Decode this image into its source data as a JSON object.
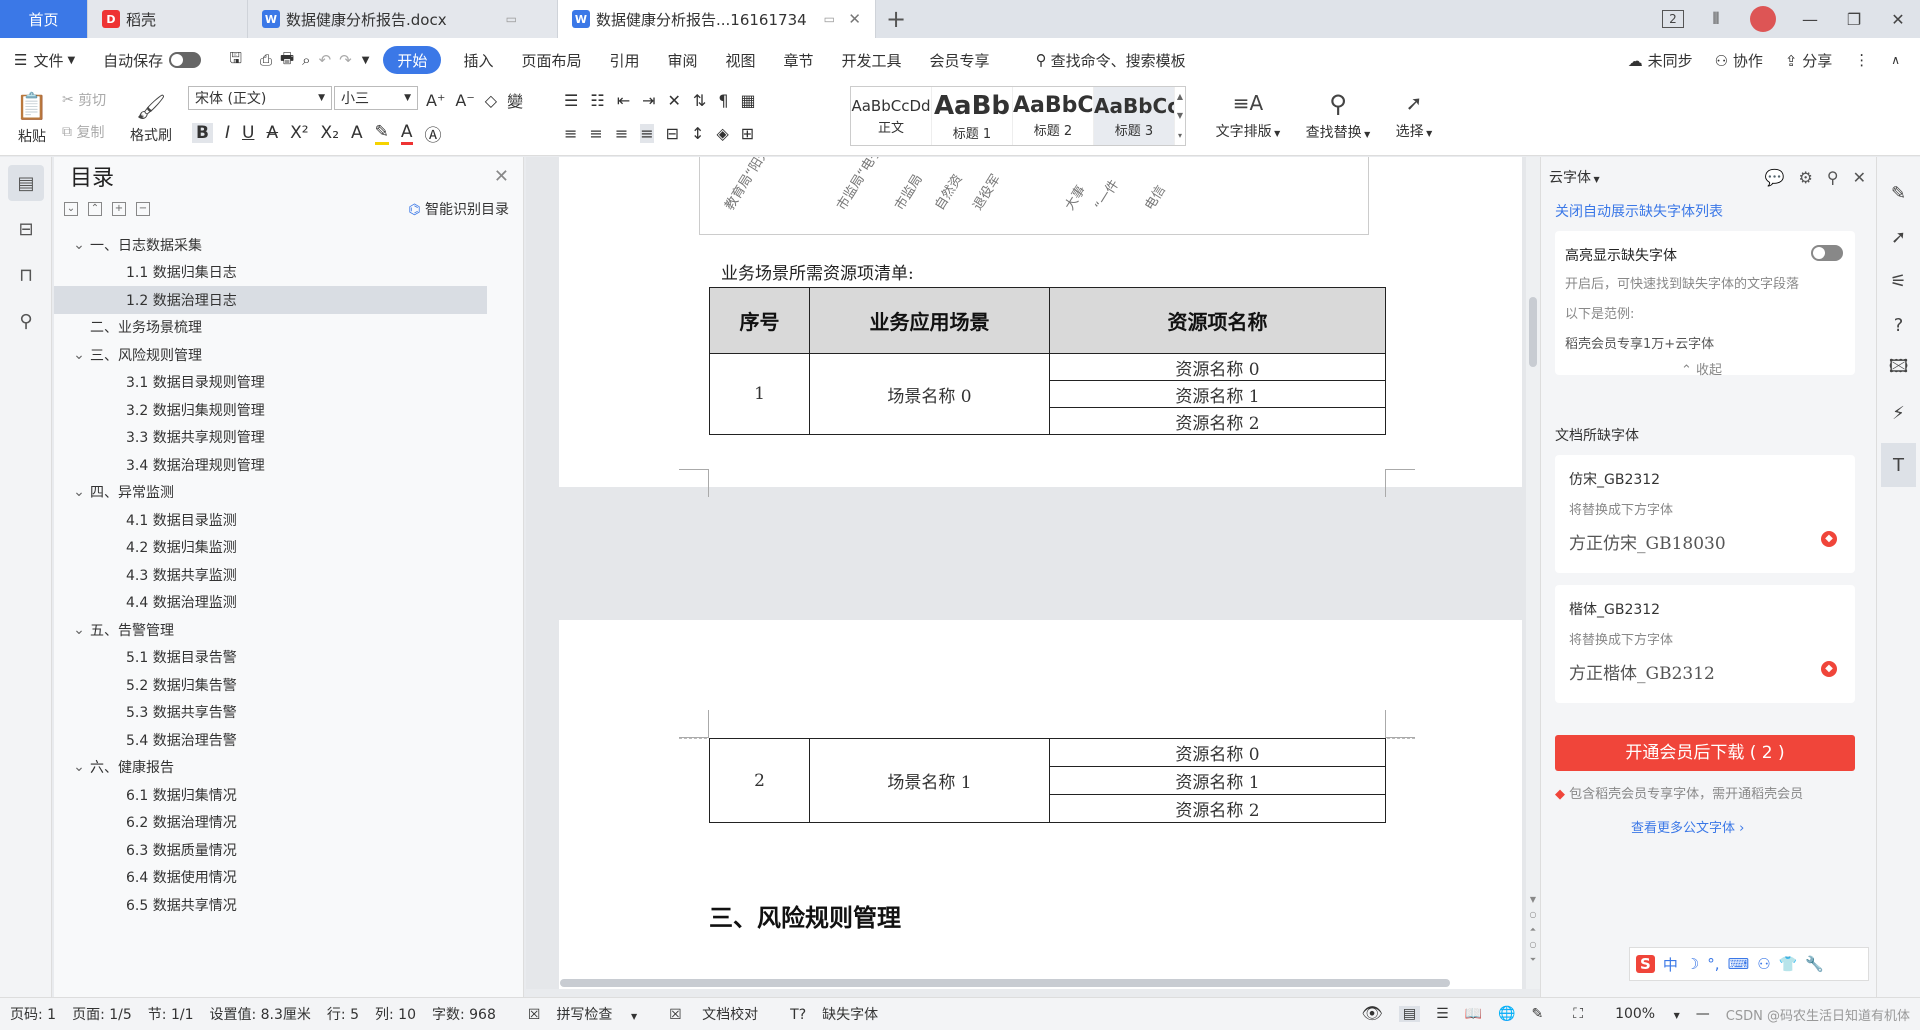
{
  "tabs": [
    {
      "label": "首页"
    },
    {
      "label": "稻壳"
    },
    {
      "label": "数据健康分析报告.docx"
    },
    {
      "label": "数据健康分析报告...16161734"
    }
  ],
  "window": {
    "badge": "2"
  },
  "menu": {
    "file": "文件",
    "autosave": "自动保存",
    "start": "开始",
    "insert": "插入",
    "layout": "页面布局",
    "ref": "引用",
    "review": "审阅",
    "view": "视图",
    "chapter": "章节",
    "dev": "开发工具",
    "vip": "会员专享",
    "search": "查找命令、搜索模板",
    "sync": "未同步",
    "collab": "协作",
    "share": "分享"
  },
  "ribbon": {
    "paste": "粘贴",
    "cut": "剪切",
    "copy": "复制",
    "painter": "格式刷",
    "font": "宋体 (正文)",
    "size": "小三",
    "styles": [
      {
        "preview": "AaBbCcDd",
        "label": "正文"
      },
      {
        "preview": "AaBb",
        "label": "标题 1"
      },
      {
        "preview": "AaBbC",
        "label": "标题 2"
      },
      {
        "preview": "AaBbCc",
        "label": "标题 3"
      }
    ],
    "typeset": "文字排版",
    "findreplace": "查找替换",
    "select": "选择"
  },
  "toc": {
    "title": "目录",
    "smart": "智能识别目录",
    "items": [
      {
        "text": "一、日志数据采集",
        "level": 1,
        "chev": true
      },
      {
        "text": "1.1 数据归集日志",
        "level": 2
      },
      {
        "text": "1.2 数据治理日志",
        "level": 2,
        "selected": true
      },
      {
        "text": "二、业务场景梳理",
        "level": 1
      },
      {
        "text": "三、风险规则管理",
        "level": 1,
        "chev": true
      },
      {
        "text": "3.1 数据目录规则管理",
        "level": 2
      },
      {
        "text": "3.2 数据归集规则管理",
        "level": 2
      },
      {
        "text": "3.3 数据共享规则管理",
        "level": 2
      },
      {
        "text": "3.4 数据治理规则管理",
        "level": 2
      },
      {
        "text": "四、异常监测",
        "level": 1,
        "chev": true
      },
      {
        "text": "4.1 数据目录监测",
        "level": 2
      },
      {
        "text": "4.2 数据归集监测",
        "level": 2
      },
      {
        "text": "4.3 数据共享监测",
        "level": 2
      },
      {
        "text": "4.4 数据治理监测",
        "level": 2
      },
      {
        "text": "五、告警管理",
        "level": 1,
        "chev": true
      },
      {
        "text": "5.1 数据目录告警",
        "level": 2
      },
      {
        "text": "5.2 数据归集告警",
        "level": 2
      },
      {
        "text": "5.3 数据共享告警",
        "level": 2
      },
      {
        "text": "5.4 数据治理告警",
        "level": 2
      },
      {
        "text": "六、健康报告",
        "level": 1,
        "chev": true
      },
      {
        "text": "6.1 数据归集情况",
        "level": 2
      },
      {
        "text": "6.2 数据治理情况",
        "level": 2
      },
      {
        "text": "6.3 数据质量情况",
        "level": 2
      },
      {
        "text": "6.4 数据使用情况",
        "level": 2
      },
      {
        "text": "6.5 数据共享情况",
        "level": 2
      }
    ]
  },
  "doc": {
    "rotated": [
      "教育局“阳光",
      "市监局“电子",
      "市监局",
      "自然资",
      "退役军",
      "大事",
      "“一件",
      "电信"
    ],
    "listtitle": "业务场景所需资源项清单:",
    "headers": [
      "序号",
      "业务应用场景",
      "资源项名称"
    ],
    "rows": [
      {
        "no": "1",
        "scene": "场景名称 0",
        "res": [
          "资源名称 0",
          "资源名称 1",
          "资源名称 2"
        ]
      },
      {
        "no": "2",
        "scene": "场景名称 1",
        "res": [
          "资源名称 0",
          "资源名称 1",
          "资源名称 2"
        ]
      }
    ],
    "heading": "三、风险规则管理"
  },
  "panel": {
    "title": "云字体",
    "closeauto": "关闭自动展示缺失字体列表",
    "highlight": "高亮显示缺失字体",
    "desc": "开启后，可快速找到缺失字体的文字段落",
    "example": "以下是范例:",
    "vipfont": "稻壳会员专享1万+云字体",
    "collapse": "收起",
    "missing": "文档所缺字体",
    "replace_hint": "将替换成下方字体",
    "fonts": [
      {
        "name": "仿宋_GB2312",
        "repl": "方正仿宋_GB18030"
      },
      {
        "name": "楷体_GB2312",
        "repl": "方正楷体_GB2312"
      }
    ],
    "download": "开通会员后下载 ( 2 )",
    "note": "包含稻壳会员专享字体，需开通稻壳会员",
    "more": "查看更多公文字体"
  },
  "status": {
    "pageno": "页码: 1",
    "page": "页面: 1/5",
    "sect": "节: 1/1",
    "setting": "设置值: 8.3厘米",
    "row": "行: 5",
    "col": "列: 10",
    "words": "字数: 968",
    "spell": "拼写检查",
    "proof": "文档校对",
    "missingfont": "缺失字体",
    "zoom": "100%",
    "watermark": "CSDN @码农生活日知道有机体"
  },
  "colors": {
    "accent": "#3b78e7",
    "download": "#f0453a"
  }
}
